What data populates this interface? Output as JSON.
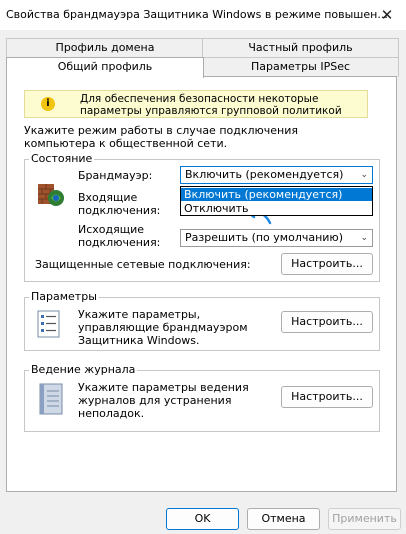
{
  "window": {
    "title": "Свойства брандмауэра Защитника Windows в режиме повышен...",
    "close_glyph": "✕"
  },
  "tabs": {
    "row1": [
      "Профиль домена",
      "Частный профиль"
    ],
    "row2": [
      "Общий профиль",
      "Параметры IPSec"
    ],
    "active": "Общий профиль"
  },
  "info_banner": {
    "icon": "i",
    "text": "Для обеспечения безопасности некоторые параметры управляются групповой политикой"
  },
  "instruction": "Укажите режим работы в случае подключения компьютера к общественной сети.",
  "state": {
    "legend": "Состояние",
    "firewall_label": "Брандмауэр:",
    "firewall_value": "Включить (рекомендуется)",
    "firewall_options": [
      "Включить (рекомендуется)",
      "Отключить"
    ],
    "inbound_label": "Входящие подключения:",
    "outbound_label": "Исходящие подключения:",
    "outbound_value": "Разрешить (по умолчанию)",
    "protected_label": "Защищенные сетевые подключения:",
    "configure": "Настроить..."
  },
  "settings": {
    "legend": "Параметры",
    "text": "Укажите параметры, управляющие брандмауэром Защитника Windows.",
    "configure": "Настроить..."
  },
  "logging": {
    "legend": "Ведение журнала",
    "text": "Укажите параметры ведения журналов для устранения неполадок.",
    "configure": "Настроить..."
  },
  "footer": {
    "ok": "OK",
    "cancel": "Отмена",
    "apply": "Применить"
  },
  "colors": {
    "accent": "#0078d4",
    "info_bg": "#fdfbd0"
  }
}
